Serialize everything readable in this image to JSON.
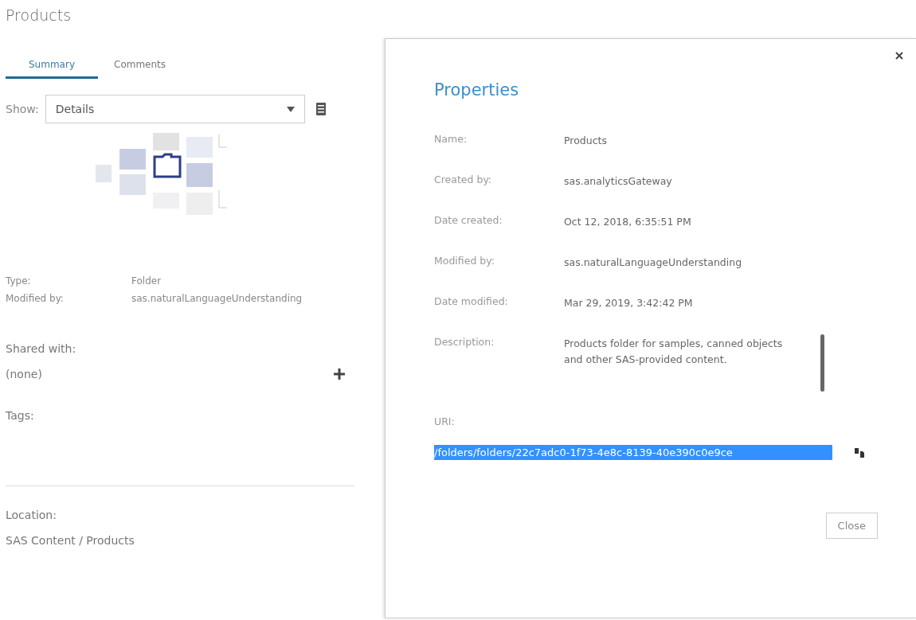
{
  "page": {
    "title": "Products"
  },
  "tabs": [
    {
      "label": "Summary",
      "selected": true
    },
    {
      "label": "Comments",
      "selected": false
    }
  ],
  "show": {
    "label": "Show:",
    "value": "Details"
  },
  "details": [
    {
      "label": "Type:",
      "value": "Folder"
    },
    {
      "label": "Modified by:",
      "value": "sas.naturalLanguageUnderstanding"
    }
  ],
  "shared": {
    "label": "Shared with:",
    "value": "(none)"
  },
  "tags": {
    "label": "Tags:"
  },
  "location": {
    "label": "Location:",
    "value": "SAS Content / Products"
  },
  "dialog": {
    "title": "Properties",
    "fields": [
      {
        "label": "Name:",
        "value": "Products"
      },
      {
        "label": "Created by:",
        "value": "sas.analyticsGateway"
      },
      {
        "label": "Date created:",
        "value": "Oct 12, 2018, 6:35:51 PM"
      },
      {
        "label": "Modified by:",
        "value": "sas.naturalLanguageUnderstanding"
      },
      {
        "label": "Date modified:",
        "value": "Mar 29, 2019, 3:42:42 PM"
      },
      {
        "label": "Description:",
        "value": "Products folder for samples, canned objects and other SAS-provided content."
      }
    ],
    "uri": {
      "label": "URI:",
      "value": "/folders/folders/22c7adc0-1f73-4e8c-8139-40e390c0e9ce",
      "selected": true
    },
    "buttons": [
      "Close"
    ]
  }
}
